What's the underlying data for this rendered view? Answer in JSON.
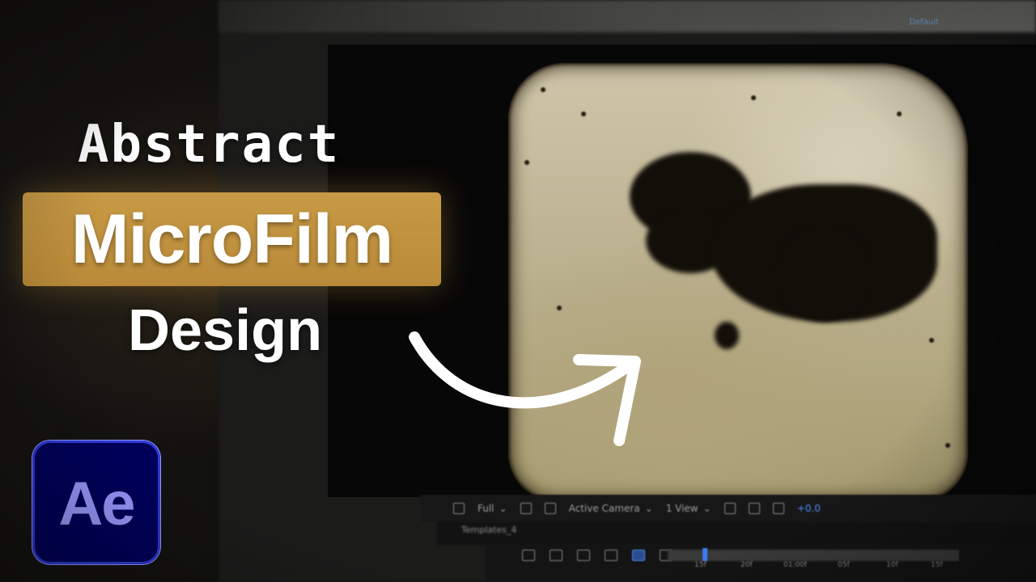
{
  "title": {
    "line1": "Abstract",
    "line2": "MicroFilm",
    "line3": "Design"
  },
  "logo": {
    "text": "Ae",
    "bg_color": "#00005b",
    "accent_color": "#9999ff"
  },
  "highlight_color": "#c89a45",
  "topbar": {
    "label": "Default"
  },
  "viewer_toolbar": {
    "resolution": "Full",
    "camera": "Active Camera",
    "views": "1 View",
    "exposure": "+0.0"
  },
  "composition_tab": {
    "label": "Templates_4"
  },
  "timeline": {
    "ruler_labels": [
      "15f",
      "20f",
      "01:00f",
      "05f",
      "10f",
      "15f"
    ]
  }
}
